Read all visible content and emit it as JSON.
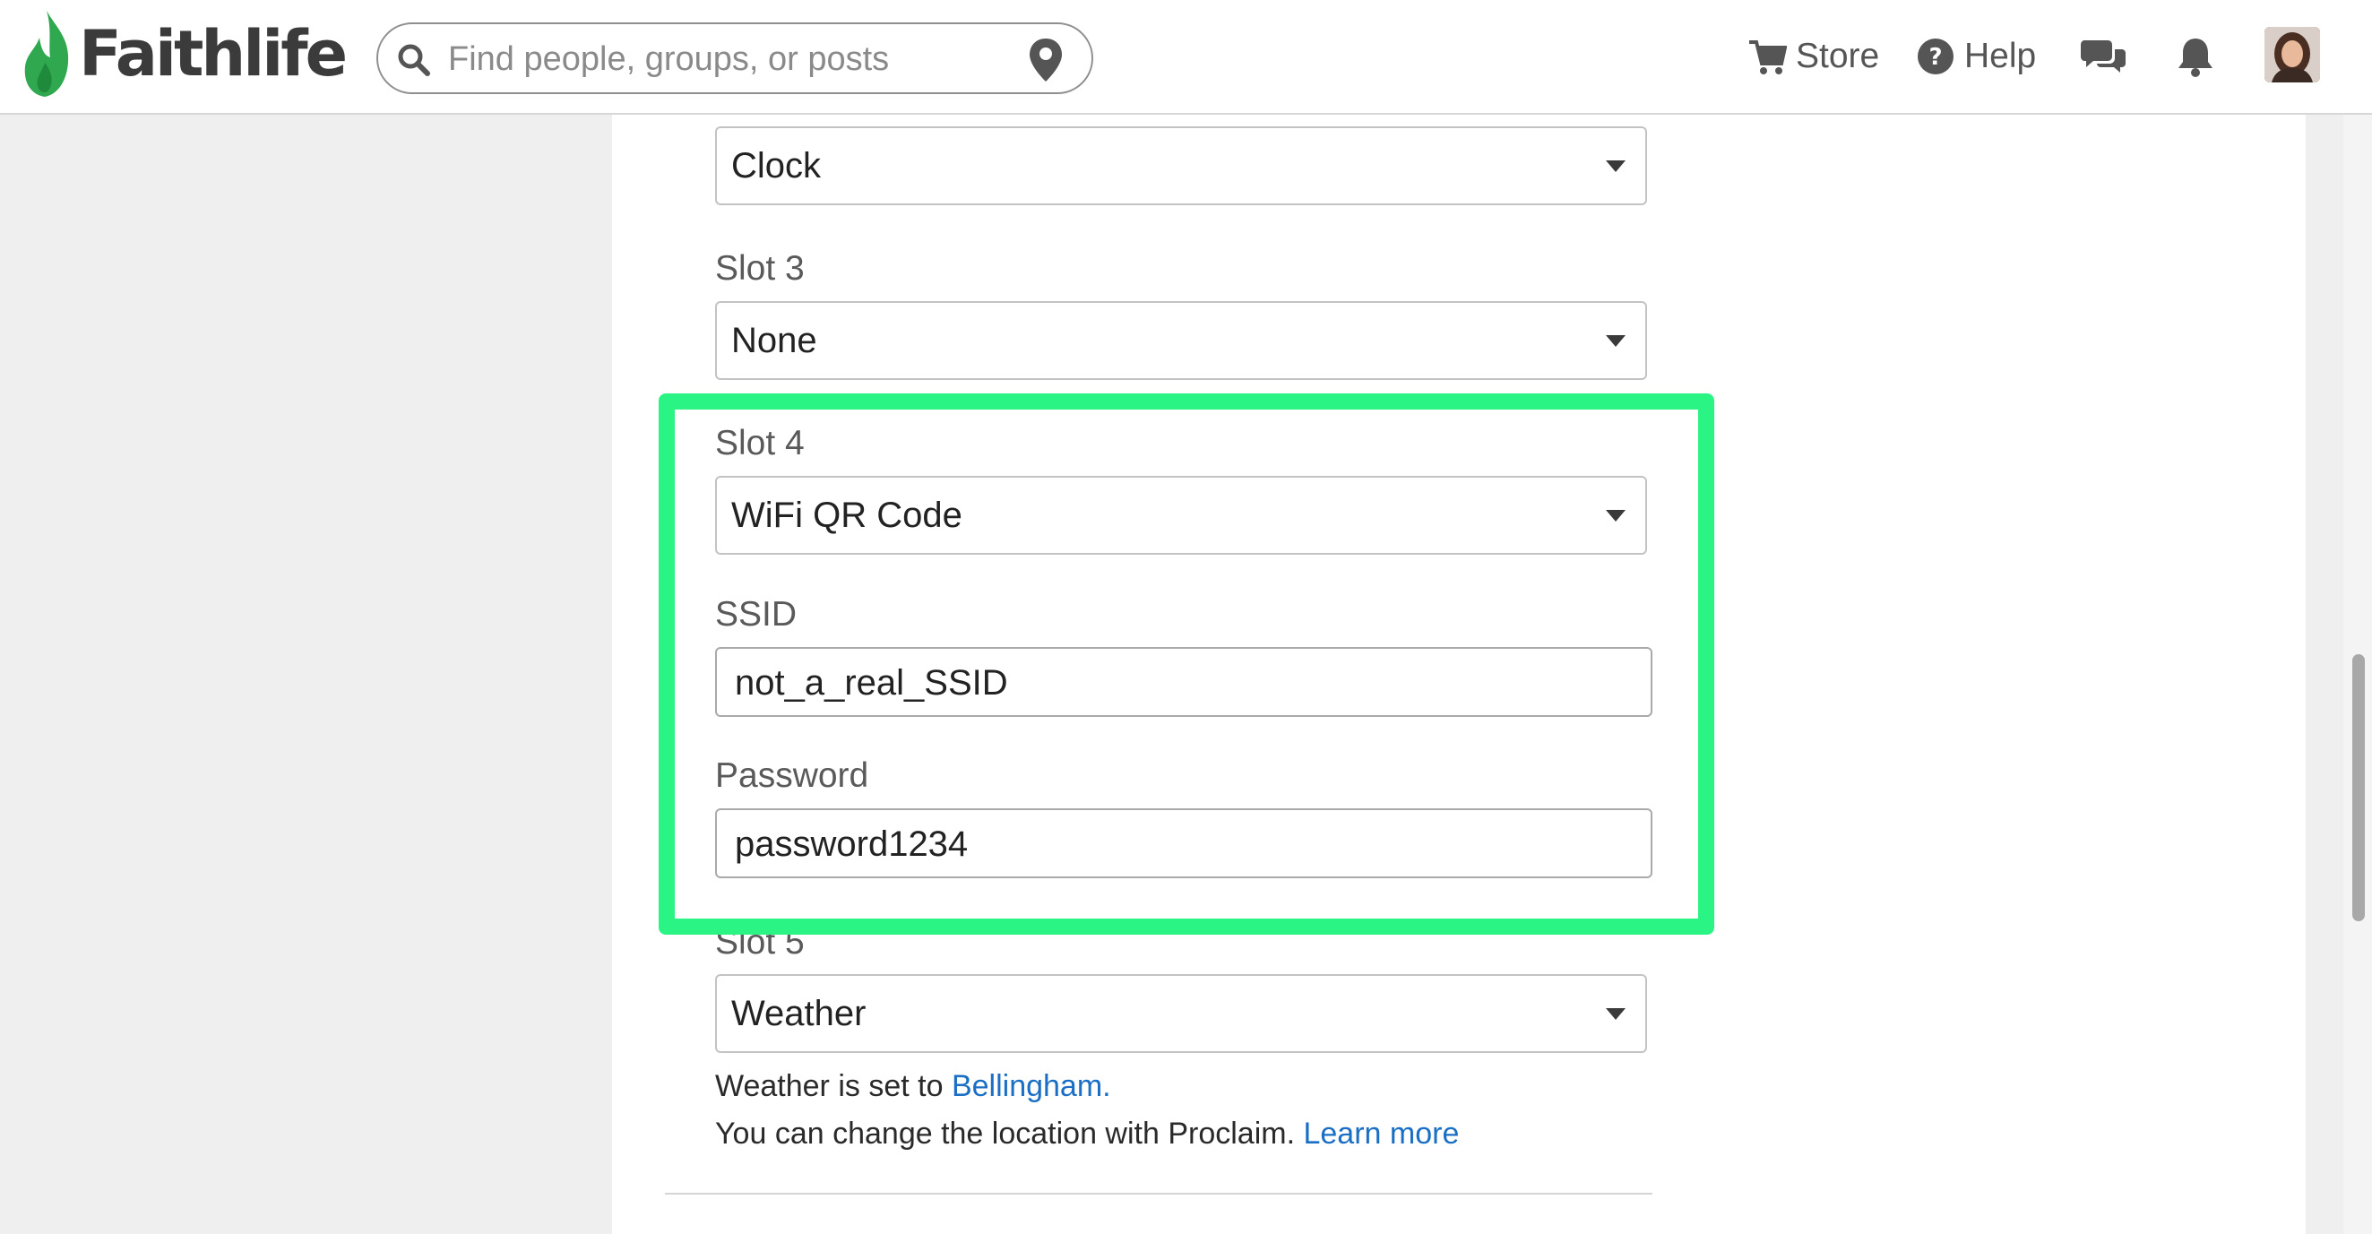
{
  "header": {
    "logo_text": "Faithlife",
    "search_placeholder": "Find people, groups, or posts",
    "store_label": "Store",
    "help_label": "Help"
  },
  "form": {
    "slot2_value": "Clock",
    "slot3_label": "Slot 3",
    "slot3_value": "None",
    "slot4_label": "Slot 4",
    "slot4_value": "WiFi QR Code",
    "ssid_label": "SSID",
    "ssid_value": "not_a_real_SSID",
    "password_label": "Password",
    "password_value": "password1234",
    "slot5_label": "Slot 5",
    "slot5_value": "Weather",
    "weather_note_prefix": "Weather is set to",
    "weather_location_link": "Bellingham.",
    "change_note": "You can change the location with Proclaim.",
    "learn_more_link": "Learn more"
  },
  "colors": {
    "highlight": "#2af584",
    "link": "#1a6fc4",
    "logo_green": "#2fa84f"
  },
  "icons": [
    "flame-logo-icon",
    "search-icon",
    "location-pin-icon",
    "cart-icon",
    "help-icon",
    "chat-icon",
    "bell-icon"
  ]
}
